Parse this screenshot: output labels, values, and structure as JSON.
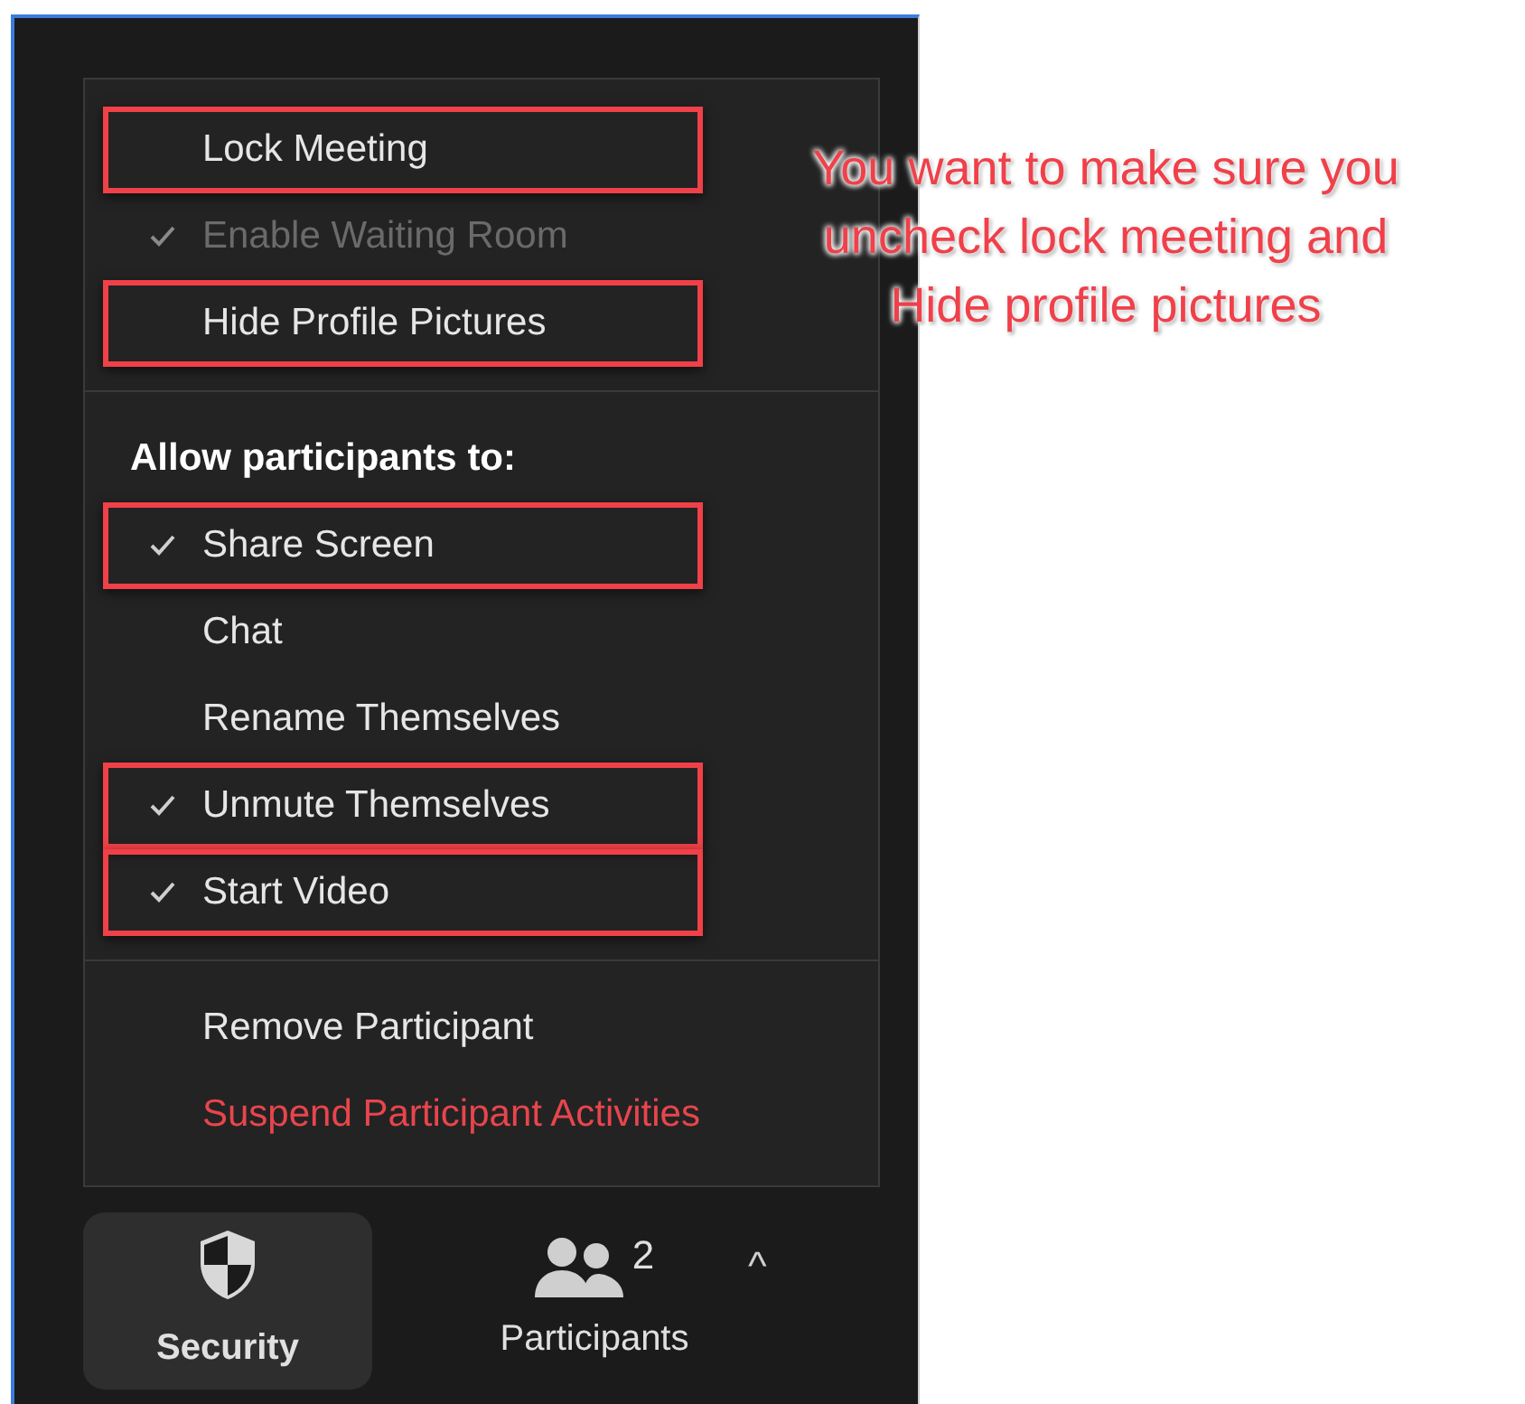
{
  "menu": {
    "sections": [
      {
        "items": [
          {
            "label": "Lock Meeting",
            "kind": "option",
            "checked": false,
            "disabled": false,
            "highlighted": true
          },
          {
            "label": "Enable Waiting Room",
            "kind": "option",
            "checked": true,
            "disabled": true,
            "highlighted": false
          },
          {
            "label": "Hide Profile Pictures",
            "kind": "option",
            "checked": false,
            "disabled": false,
            "highlighted": true
          }
        ]
      },
      {
        "heading": "Allow participants to:",
        "items": [
          {
            "label": "Share Screen",
            "kind": "option",
            "checked": true,
            "disabled": false,
            "highlighted": true
          },
          {
            "label": "Chat",
            "kind": "option",
            "checked": false,
            "disabled": false,
            "highlighted": false
          },
          {
            "label": "Rename Themselves",
            "kind": "option",
            "checked": false,
            "disabled": false,
            "highlighted": false
          },
          {
            "label": "Unmute Themselves",
            "kind": "option",
            "checked": true,
            "disabled": false,
            "highlighted": true
          },
          {
            "label": "Start Video",
            "kind": "option",
            "checked": true,
            "disabled": false,
            "highlighted": true
          }
        ]
      },
      {
        "items": [
          {
            "label": "Remove Participant",
            "kind": "action",
            "disabled": false,
            "highlighted": false
          },
          {
            "label": "Suspend Participant Activities",
            "kind": "danger",
            "disabled": false,
            "highlighted": false
          }
        ]
      }
    ]
  },
  "toolbar": {
    "security": {
      "label": "Security",
      "selected": true
    },
    "participants": {
      "label": "Participants",
      "count": "2",
      "caret": "^"
    }
  },
  "callout": {
    "lines": [
      "You want to make sure you",
      "uncheck lock meeting and",
      "Hide profile pictures"
    ]
  }
}
